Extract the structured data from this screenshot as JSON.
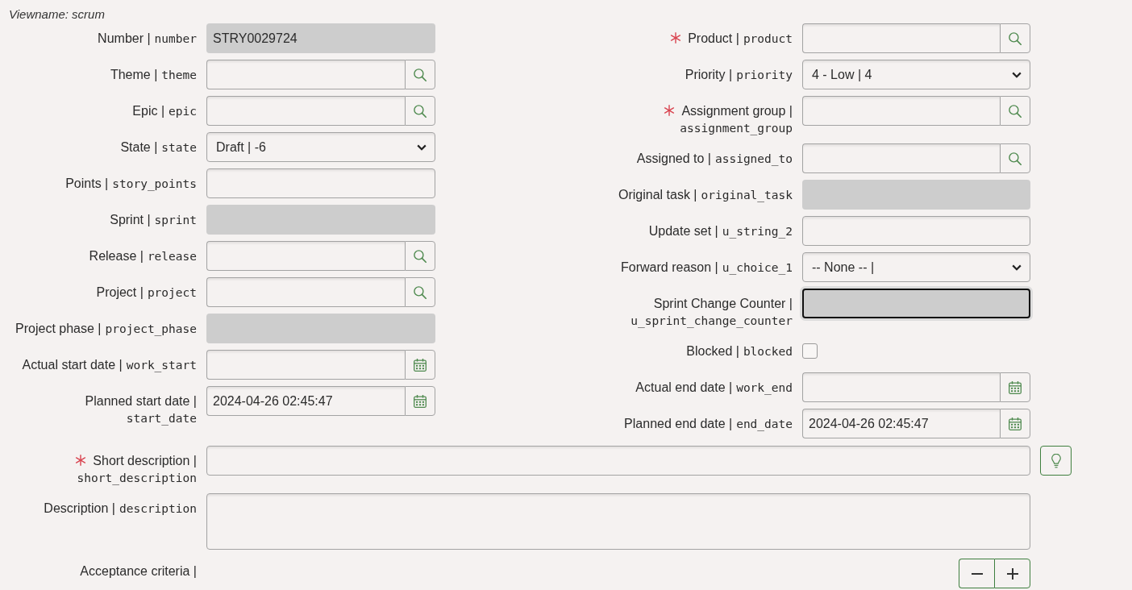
{
  "view_name": "Viewname: scrum",
  "left_fields": [
    {
      "label": "Number |",
      "name": "number",
      "kind": "readonly",
      "value": "STRY0029724",
      "required": false,
      "focused": false
    },
    {
      "label": "Theme |",
      "name": "theme",
      "kind": "reference",
      "required": false,
      "focused": false
    },
    {
      "label": "Epic |",
      "name": "epic",
      "kind": "reference",
      "required": false,
      "focused": false
    },
    {
      "label": "State |",
      "name": "state",
      "kind": "select",
      "value": "Draft | -6",
      "required": false,
      "focused": false
    },
    {
      "label": "Points |",
      "name": "story_points",
      "kind": "text",
      "required": false,
      "focused": false
    },
    {
      "label": "Sprint |",
      "name": "sprint",
      "kind": "readonly",
      "required": false,
      "focused": false
    },
    {
      "label": "Release |",
      "name": "release",
      "kind": "reference",
      "required": false,
      "focused": false
    },
    {
      "label": "Project |",
      "name": "project",
      "kind": "reference",
      "required": false,
      "focused": false
    },
    {
      "label": "Project phase |",
      "name": "project_phase",
      "kind": "readonly",
      "required": false,
      "focused": false
    },
    {
      "label": "Actual start date |",
      "name": "work_start",
      "kind": "date",
      "required": false,
      "focused": false
    },
    {
      "label": "Planned start date |",
      "name": "start_date",
      "kind": "date",
      "value": "2024-04-26 02:45:47",
      "required": false,
      "focused": false
    }
  ],
  "right_fields": [
    {
      "label": "Product |",
      "name": "product",
      "kind": "reference",
      "required": true,
      "focused": false
    },
    {
      "label": "Priority |",
      "name": "priority",
      "kind": "select",
      "value": "4 - Low | 4",
      "required": false,
      "focused": false
    },
    {
      "label": "Assignment group |",
      "name": "assignment_group",
      "kind": "reference",
      "required": true,
      "focused": false
    },
    {
      "label": "Assigned to |",
      "name": "assigned_to",
      "kind": "reference",
      "required": false,
      "focused": false
    },
    {
      "label": "Original task |",
      "name": "original_task",
      "kind": "readonly",
      "required": false,
      "focused": false
    },
    {
      "label": "Update set |",
      "name": "u_string_2",
      "kind": "text",
      "required": false,
      "focused": false
    },
    {
      "label": "Forward reason |",
      "name": "u_choice_1",
      "kind": "select",
      "value": "-- None -- |",
      "required": false,
      "focused": false
    },
    {
      "label": "Sprint Change Counter |",
      "name": "u_sprint_change_counter",
      "kind": "readonly",
      "required": false,
      "focused": true
    },
    {
      "label": "Blocked |",
      "name": "blocked",
      "kind": "checkbox",
      "checked": false,
      "required": false,
      "focused": false
    },
    {
      "label": "Actual end date |",
      "name": "work_end",
      "kind": "date",
      "required": false,
      "focused": false
    },
    {
      "label": "Planned end date |",
      "name": "end_date",
      "kind": "date",
      "value": "2024-04-26 02:45:47",
      "required": false,
      "focused": false
    }
  ],
  "wide_fields": [
    {
      "label": "Short description |",
      "name": "short_description",
      "kind": "suggest_text",
      "required": true,
      "focused": false
    },
    {
      "label": "Description |",
      "name": "description",
      "kind": "textarea",
      "required": false,
      "focused": false
    },
    {
      "label": "Acceptance criteria |",
      "kind": "collapsible",
      "required": false
    }
  ]
}
